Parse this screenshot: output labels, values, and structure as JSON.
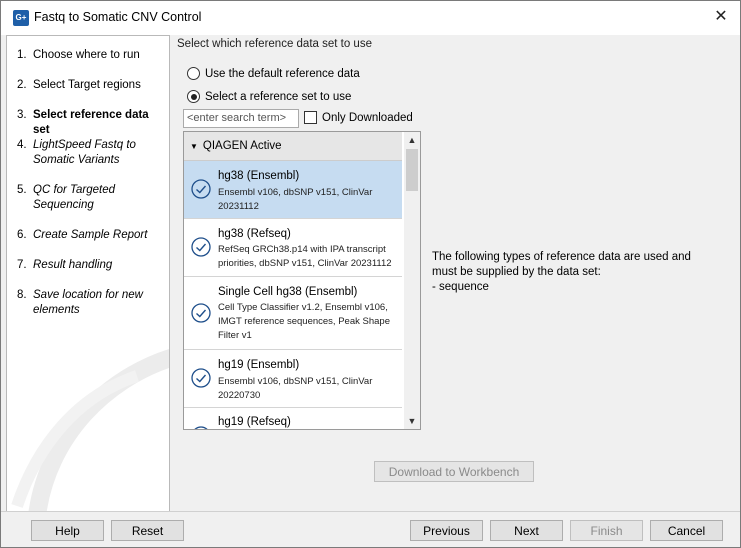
{
  "window": {
    "title": "Fastq to Somatic CNV Control",
    "icon_text": "G+"
  },
  "steps": [
    {
      "num": "1.",
      "label": "Choose where to run"
    },
    {
      "num": "2.",
      "label": "Select Target regions"
    },
    {
      "num": "3.",
      "label": "Select reference data set"
    },
    {
      "num": "4.",
      "label": "LightSpeed Fastq to Somatic Variants"
    },
    {
      "num": "5.",
      "label": "QC for Targeted Sequencing"
    },
    {
      "num": "6.",
      "label": "Create Sample Report"
    },
    {
      "num": "7.",
      "label": "Result handling"
    },
    {
      "num": "8.",
      "label": "Save location for new elements"
    }
  ],
  "main": {
    "heading": "Select which reference data set to use",
    "radio_default": "Use the default reference data",
    "radio_select": "Select a reference set to use",
    "search_placeholder": "<enter search term>",
    "only_downloaded": "Only Downloaded",
    "group_label": "QIAGEN Active",
    "items": [
      {
        "name": "hg38 (Ensembl)",
        "desc": "Ensembl v106, dbSNP v151, ClinVar 20231112"
      },
      {
        "name": "hg38 (Refseq)",
        "desc": "RefSeq GRCh38.p14 with IPA transcript priorities, dbSNP v151, ClinVar 20231112"
      },
      {
        "name": "Single Cell hg38 (Ensembl)",
        "desc": "Cell Type Classifier v1.2, Ensembl v106, IMGT reference sequences, Peak Shape Filter v1"
      },
      {
        "name": "hg19 (Ensembl)",
        "desc": "Ensembl v106, dbSNP v151, ClinVar 20220730"
      },
      {
        "name": "hg19 (Refseq)",
        "desc": ""
      }
    ],
    "info_line1": "The following types of reference data are used and",
    "info_line2": "must be supplied by the data set:",
    "info_line3": "- sequence",
    "download_button": "Download to Workbench"
  },
  "footer": {
    "help": "Help",
    "reset": "Reset",
    "previous": "Previous",
    "next": "Next",
    "finish": "Finish",
    "cancel": "Cancel"
  },
  "colors": {
    "selected_row": "#c6dcf1",
    "check_icon": "#1f4f8b",
    "app_icon": "#1f5fa8"
  }
}
